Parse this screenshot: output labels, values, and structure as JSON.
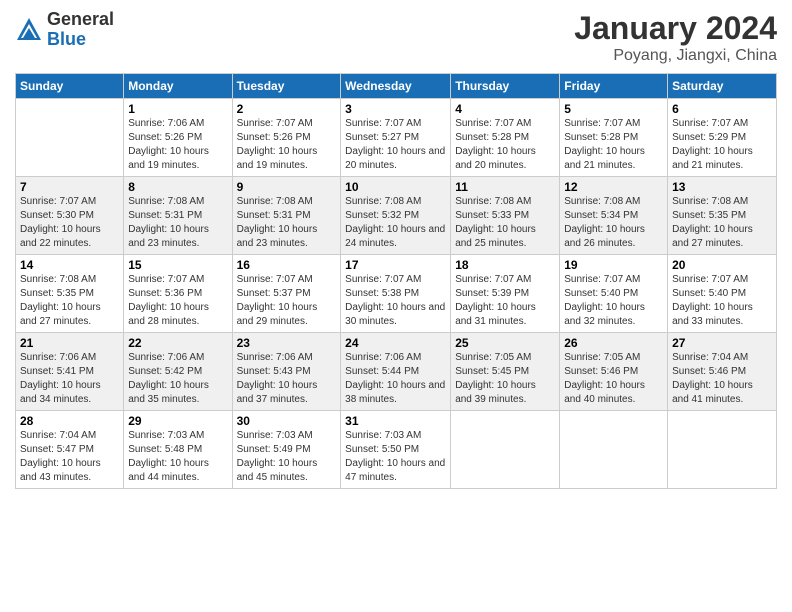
{
  "header": {
    "logo_general": "General",
    "logo_blue": "Blue",
    "title": "January 2024",
    "location": "Poyang, Jiangxi, China"
  },
  "columns": [
    "Sunday",
    "Monday",
    "Tuesday",
    "Wednesday",
    "Thursday",
    "Friday",
    "Saturday"
  ],
  "weeks": [
    [
      {
        "day": "",
        "sunrise": "",
        "sunset": "",
        "daylight": ""
      },
      {
        "day": "1",
        "sunrise": "Sunrise: 7:06 AM",
        "sunset": "Sunset: 5:26 PM",
        "daylight": "Daylight: 10 hours and 19 minutes."
      },
      {
        "day": "2",
        "sunrise": "Sunrise: 7:07 AM",
        "sunset": "Sunset: 5:26 PM",
        "daylight": "Daylight: 10 hours and 19 minutes."
      },
      {
        "day": "3",
        "sunrise": "Sunrise: 7:07 AM",
        "sunset": "Sunset: 5:27 PM",
        "daylight": "Daylight: 10 hours and 20 minutes."
      },
      {
        "day": "4",
        "sunrise": "Sunrise: 7:07 AM",
        "sunset": "Sunset: 5:28 PM",
        "daylight": "Daylight: 10 hours and 20 minutes."
      },
      {
        "day": "5",
        "sunrise": "Sunrise: 7:07 AM",
        "sunset": "Sunset: 5:28 PM",
        "daylight": "Daylight: 10 hours and 21 minutes."
      },
      {
        "day": "6",
        "sunrise": "Sunrise: 7:07 AM",
        "sunset": "Sunset: 5:29 PM",
        "daylight": "Daylight: 10 hours and 21 minutes."
      }
    ],
    [
      {
        "day": "7",
        "sunrise": "Sunrise: 7:07 AM",
        "sunset": "Sunset: 5:30 PM",
        "daylight": "Daylight: 10 hours and 22 minutes."
      },
      {
        "day": "8",
        "sunrise": "Sunrise: 7:08 AM",
        "sunset": "Sunset: 5:31 PM",
        "daylight": "Daylight: 10 hours and 23 minutes."
      },
      {
        "day": "9",
        "sunrise": "Sunrise: 7:08 AM",
        "sunset": "Sunset: 5:31 PM",
        "daylight": "Daylight: 10 hours and 23 minutes."
      },
      {
        "day": "10",
        "sunrise": "Sunrise: 7:08 AM",
        "sunset": "Sunset: 5:32 PM",
        "daylight": "Daylight: 10 hours and 24 minutes."
      },
      {
        "day": "11",
        "sunrise": "Sunrise: 7:08 AM",
        "sunset": "Sunset: 5:33 PM",
        "daylight": "Daylight: 10 hours and 25 minutes."
      },
      {
        "day": "12",
        "sunrise": "Sunrise: 7:08 AM",
        "sunset": "Sunset: 5:34 PM",
        "daylight": "Daylight: 10 hours and 26 minutes."
      },
      {
        "day": "13",
        "sunrise": "Sunrise: 7:08 AM",
        "sunset": "Sunset: 5:35 PM",
        "daylight": "Daylight: 10 hours and 27 minutes."
      }
    ],
    [
      {
        "day": "14",
        "sunrise": "Sunrise: 7:08 AM",
        "sunset": "Sunset: 5:35 PM",
        "daylight": "Daylight: 10 hours and 27 minutes."
      },
      {
        "day": "15",
        "sunrise": "Sunrise: 7:07 AM",
        "sunset": "Sunset: 5:36 PM",
        "daylight": "Daylight: 10 hours and 28 minutes."
      },
      {
        "day": "16",
        "sunrise": "Sunrise: 7:07 AM",
        "sunset": "Sunset: 5:37 PM",
        "daylight": "Daylight: 10 hours and 29 minutes."
      },
      {
        "day": "17",
        "sunrise": "Sunrise: 7:07 AM",
        "sunset": "Sunset: 5:38 PM",
        "daylight": "Daylight: 10 hours and 30 minutes."
      },
      {
        "day": "18",
        "sunrise": "Sunrise: 7:07 AM",
        "sunset": "Sunset: 5:39 PM",
        "daylight": "Daylight: 10 hours and 31 minutes."
      },
      {
        "day": "19",
        "sunrise": "Sunrise: 7:07 AM",
        "sunset": "Sunset: 5:40 PM",
        "daylight": "Daylight: 10 hours and 32 minutes."
      },
      {
        "day": "20",
        "sunrise": "Sunrise: 7:07 AM",
        "sunset": "Sunset: 5:40 PM",
        "daylight": "Daylight: 10 hours and 33 minutes."
      }
    ],
    [
      {
        "day": "21",
        "sunrise": "Sunrise: 7:06 AM",
        "sunset": "Sunset: 5:41 PM",
        "daylight": "Daylight: 10 hours and 34 minutes."
      },
      {
        "day": "22",
        "sunrise": "Sunrise: 7:06 AM",
        "sunset": "Sunset: 5:42 PM",
        "daylight": "Daylight: 10 hours and 35 minutes."
      },
      {
        "day": "23",
        "sunrise": "Sunrise: 7:06 AM",
        "sunset": "Sunset: 5:43 PM",
        "daylight": "Daylight: 10 hours and 37 minutes."
      },
      {
        "day": "24",
        "sunrise": "Sunrise: 7:06 AM",
        "sunset": "Sunset: 5:44 PM",
        "daylight": "Daylight: 10 hours and 38 minutes."
      },
      {
        "day": "25",
        "sunrise": "Sunrise: 7:05 AM",
        "sunset": "Sunset: 5:45 PM",
        "daylight": "Daylight: 10 hours and 39 minutes."
      },
      {
        "day": "26",
        "sunrise": "Sunrise: 7:05 AM",
        "sunset": "Sunset: 5:46 PM",
        "daylight": "Daylight: 10 hours and 40 minutes."
      },
      {
        "day": "27",
        "sunrise": "Sunrise: 7:04 AM",
        "sunset": "Sunset: 5:46 PM",
        "daylight": "Daylight: 10 hours and 41 minutes."
      }
    ],
    [
      {
        "day": "28",
        "sunrise": "Sunrise: 7:04 AM",
        "sunset": "Sunset: 5:47 PM",
        "daylight": "Daylight: 10 hours and 43 minutes."
      },
      {
        "day": "29",
        "sunrise": "Sunrise: 7:03 AM",
        "sunset": "Sunset: 5:48 PM",
        "daylight": "Daylight: 10 hours and 44 minutes."
      },
      {
        "day": "30",
        "sunrise": "Sunrise: 7:03 AM",
        "sunset": "Sunset: 5:49 PM",
        "daylight": "Daylight: 10 hours and 45 minutes."
      },
      {
        "day": "31",
        "sunrise": "Sunrise: 7:03 AM",
        "sunset": "Sunset: 5:50 PM",
        "daylight": "Daylight: 10 hours and 47 minutes."
      },
      {
        "day": "",
        "sunrise": "",
        "sunset": "",
        "daylight": ""
      },
      {
        "day": "",
        "sunrise": "",
        "sunset": "",
        "daylight": ""
      },
      {
        "day": "",
        "sunrise": "",
        "sunset": "",
        "daylight": ""
      }
    ]
  ]
}
